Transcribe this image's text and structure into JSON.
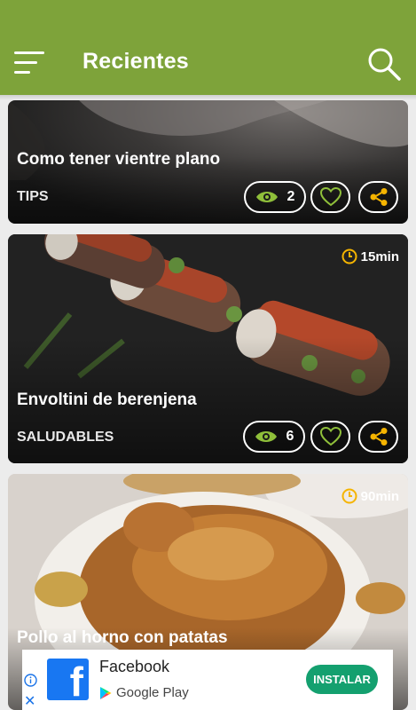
{
  "app": {
    "title": "Recientes"
  },
  "colors": {
    "primary": "#7ea33a",
    "accent": "#f5b400",
    "install": "#14a06f"
  },
  "icons": {
    "menu": "menu-icon",
    "search": "search-icon",
    "views": "eye-icon",
    "like": "heart-icon",
    "share": "share-icon",
    "time": "clock-icon"
  },
  "cards": [
    {
      "title": "Como tener vientre plano",
      "category": "TIPS",
      "views": "2"
    },
    {
      "title": "Envoltini de berenjena",
      "category": "SALUDABLES",
      "views": "6",
      "time": "15min"
    },
    {
      "title": "Pollo al horno con patatas",
      "time": "90min"
    }
  ],
  "ad": {
    "app_name": "Facebook",
    "store": "Google Play",
    "install_label": "INSTALAR",
    "close": "✕"
  }
}
